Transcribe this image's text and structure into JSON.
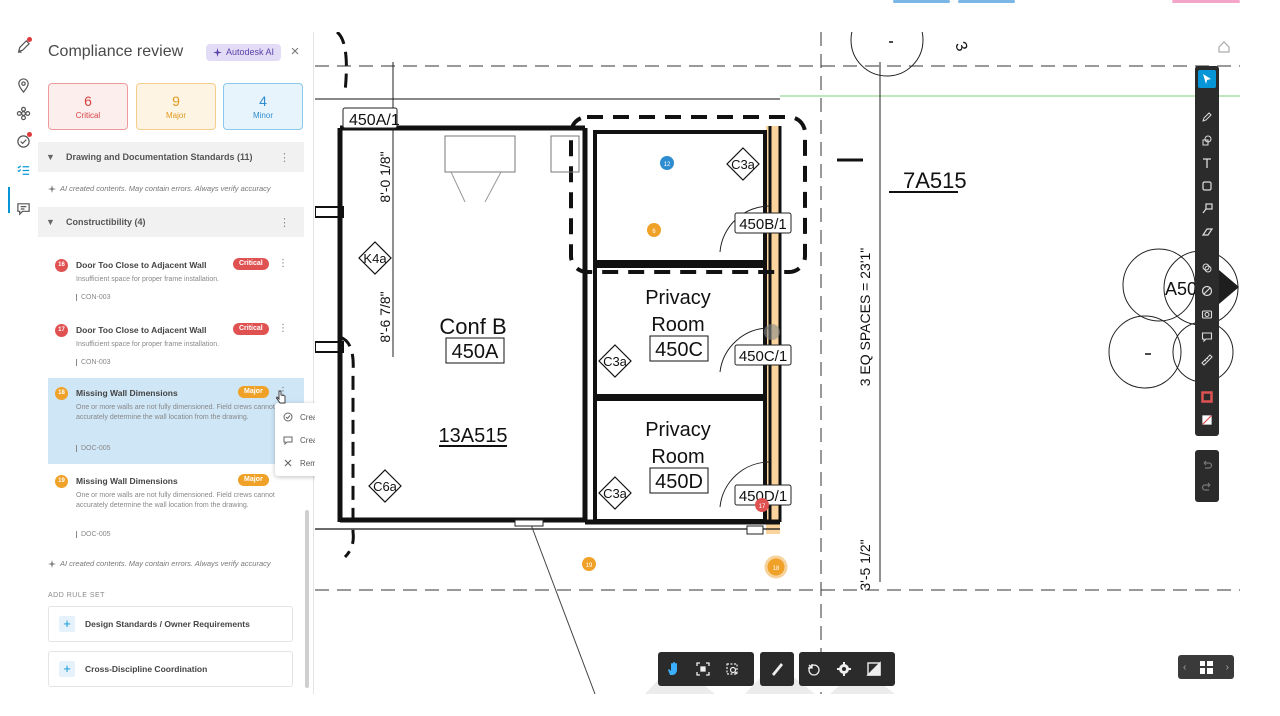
{
  "colors": {
    "accent": "#0696d7",
    "critical": "#e05252",
    "major": "#f0a127",
    "minor": "#2e8cd0",
    "toolbar_bg": "#2b2b2b",
    "highlight_orange": "#f6b14a"
  },
  "panel": {
    "title": "Compliance review",
    "ai_badge": "Autodesk AI",
    "close": "×"
  },
  "severity": {
    "critical": {
      "count": "6",
      "label": "Critical"
    },
    "major": {
      "count": "9",
      "label": "Major"
    },
    "minor": {
      "count": "4",
      "label": "Minor"
    }
  },
  "sections": [
    {
      "title": "Drawing and Documentation Standards (11)",
      "note": "AI created contents. May contain errors. Always verify accuracy"
    },
    {
      "title": "Constructibility (4)",
      "note": "AI created contents. May contain errors. Always verify accuracy"
    }
  ],
  "issues": [
    {
      "marker": "16",
      "title": "Door Too Close to Adjacent Wall",
      "severity": "Critical",
      "desc": "Insufficient space for proper frame installation.",
      "code": "CON-003"
    },
    {
      "marker": "17",
      "title": "Door Too Close to Adjacent Wall",
      "severity": "Critical",
      "desc": "Insufficient space for proper frame installation.",
      "code": "CON-003"
    },
    {
      "marker": "18",
      "title": "Missing Wall Dimensions",
      "severity": "Major",
      "desc": "One or more walls are not fully dimensioned. Field crews cannot accurately determine the wall location from the drawing.",
      "code": "DOC-005"
    },
    {
      "marker": "19",
      "title": "Missing Wall Dimensions",
      "severity": "Major",
      "desc": "One or more walls are not fully dimensioned. Field crews cannot accurately determine the wall location from the drawing.",
      "code": "DOC-005"
    }
  ],
  "context_menu": {
    "create_issue": "Create Issue",
    "create_rfi": "Create RFI",
    "remove": "Remove"
  },
  "add_rule_set": {
    "label": "ADD RULE SET",
    "items": [
      "Design Standards / Owner Requirements",
      "Cross-Discipline Coordination"
    ]
  },
  "drawing": {
    "labels": {
      "tag_450a1": "450A/1",
      "dim_8_0": "8'-0 1/8\"",
      "dim_8_6": "8'-6 7/8\"",
      "k4a": "K4a",
      "conf_b": "Conf B",
      "room_450a": "450A",
      "sheet_13a515": "13A515",
      "c6a": "C6a",
      "c3a_top": "C3a",
      "tag_450b1": "450B/1",
      "privacy_1": "Privacy",
      "room_1": "Room",
      "room_450c": "450C",
      "c3a_mid": "C3a",
      "tag_450c1": "450C/1",
      "privacy_2": "Privacy",
      "room_2": "Room",
      "room_450d": "450D",
      "c3a_bot": "C3a",
      "tag_450d1": "450D/1",
      "sheet_7a515": "7A515",
      "eq_spaces": "3 EQ SPACES = 23'1\"",
      "dim_3_5": "3'-5 1/2\"",
      "a50": "A50",
      "num_3": "3",
      "pin_12": "12",
      "pin_6": "6",
      "pin_17": "17",
      "pin_19": "19",
      "pin_18": "18"
    }
  },
  "toolbar_icons": [
    "select-icon",
    "markup-pen-icon",
    "shapes-icon",
    "text-icon",
    "rectangle-icon",
    "callout-icon",
    "eraser-icon",
    "layers-icon",
    "compare-icon",
    "camera-icon",
    "comment-icon",
    "ruler-icon",
    "stroke-color-icon",
    "fill-color-icon",
    "undo-icon",
    "redo-icon"
  ],
  "bottom_icons": [
    "pan-icon",
    "fit-view-icon",
    "zoom-window-icon",
    "measure-icon",
    "first-person-icon",
    "settings-icon",
    "fullscreen-icon"
  ]
}
